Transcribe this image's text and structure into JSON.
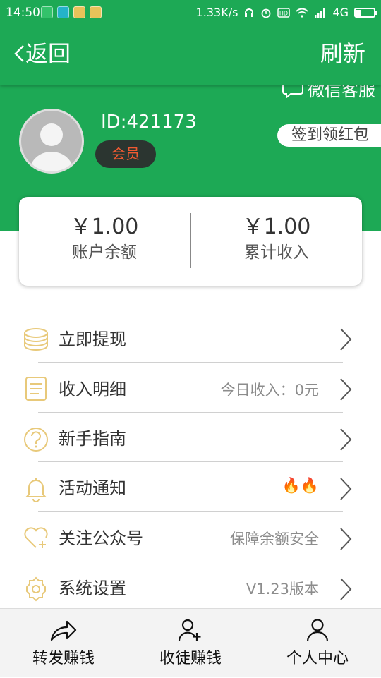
{
  "status_bar": {
    "time": "14:50",
    "network_speed": "1.33K/s",
    "signal_type": "4G",
    "battery_level": 0.25,
    "icons": [
      "headphone-icon",
      "alarm-icon",
      "hd-icon",
      "wifi-icon",
      "signal-icon",
      "battery-icon"
    ]
  },
  "appbar": {
    "back_label": "返回",
    "refresh_label": "刷新"
  },
  "profile": {
    "wechat_label": "微信客服",
    "user_id": "ID:421173",
    "member_badge": "会员",
    "signin_label": "签到领红包"
  },
  "stats": {
    "balance_value": "￥1.00",
    "balance_label": "账户余额",
    "income_value": "￥1.00",
    "income_label": "累计收入"
  },
  "menu": [
    {
      "label": "立即提现",
      "right": "",
      "icon": "coin-stack-icon"
    },
    {
      "label": "收入明细",
      "right": "今日收入：0元",
      "icon": "document-icon"
    },
    {
      "label": "新手指南",
      "right": "",
      "icon": "question-icon"
    },
    {
      "label": "活动通知",
      "right": "🔥🔥",
      "icon": "bell-icon"
    },
    {
      "label": "关注公众号",
      "right": "保障余额安全",
      "icon": "heart-plus-icon"
    },
    {
      "label": "系统设置",
      "right": "V1.23版本",
      "icon": "gear-icon"
    }
  ],
  "bottom_nav": {
    "tabs": [
      {
        "label": "转发赚钱",
        "icon": "share-icon"
      },
      {
        "label": "收徒赚钱",
        "icon": "add-user-icon"
      },
      {
        "label": "个人中心",
        "icon": "user-icon"
      }
    ]
  },
  "colors": {
    "primary_green": "#1da955",
    "icon_gold": "#e8c97a",
    "badge_red": "#f05a32"
  }
}
